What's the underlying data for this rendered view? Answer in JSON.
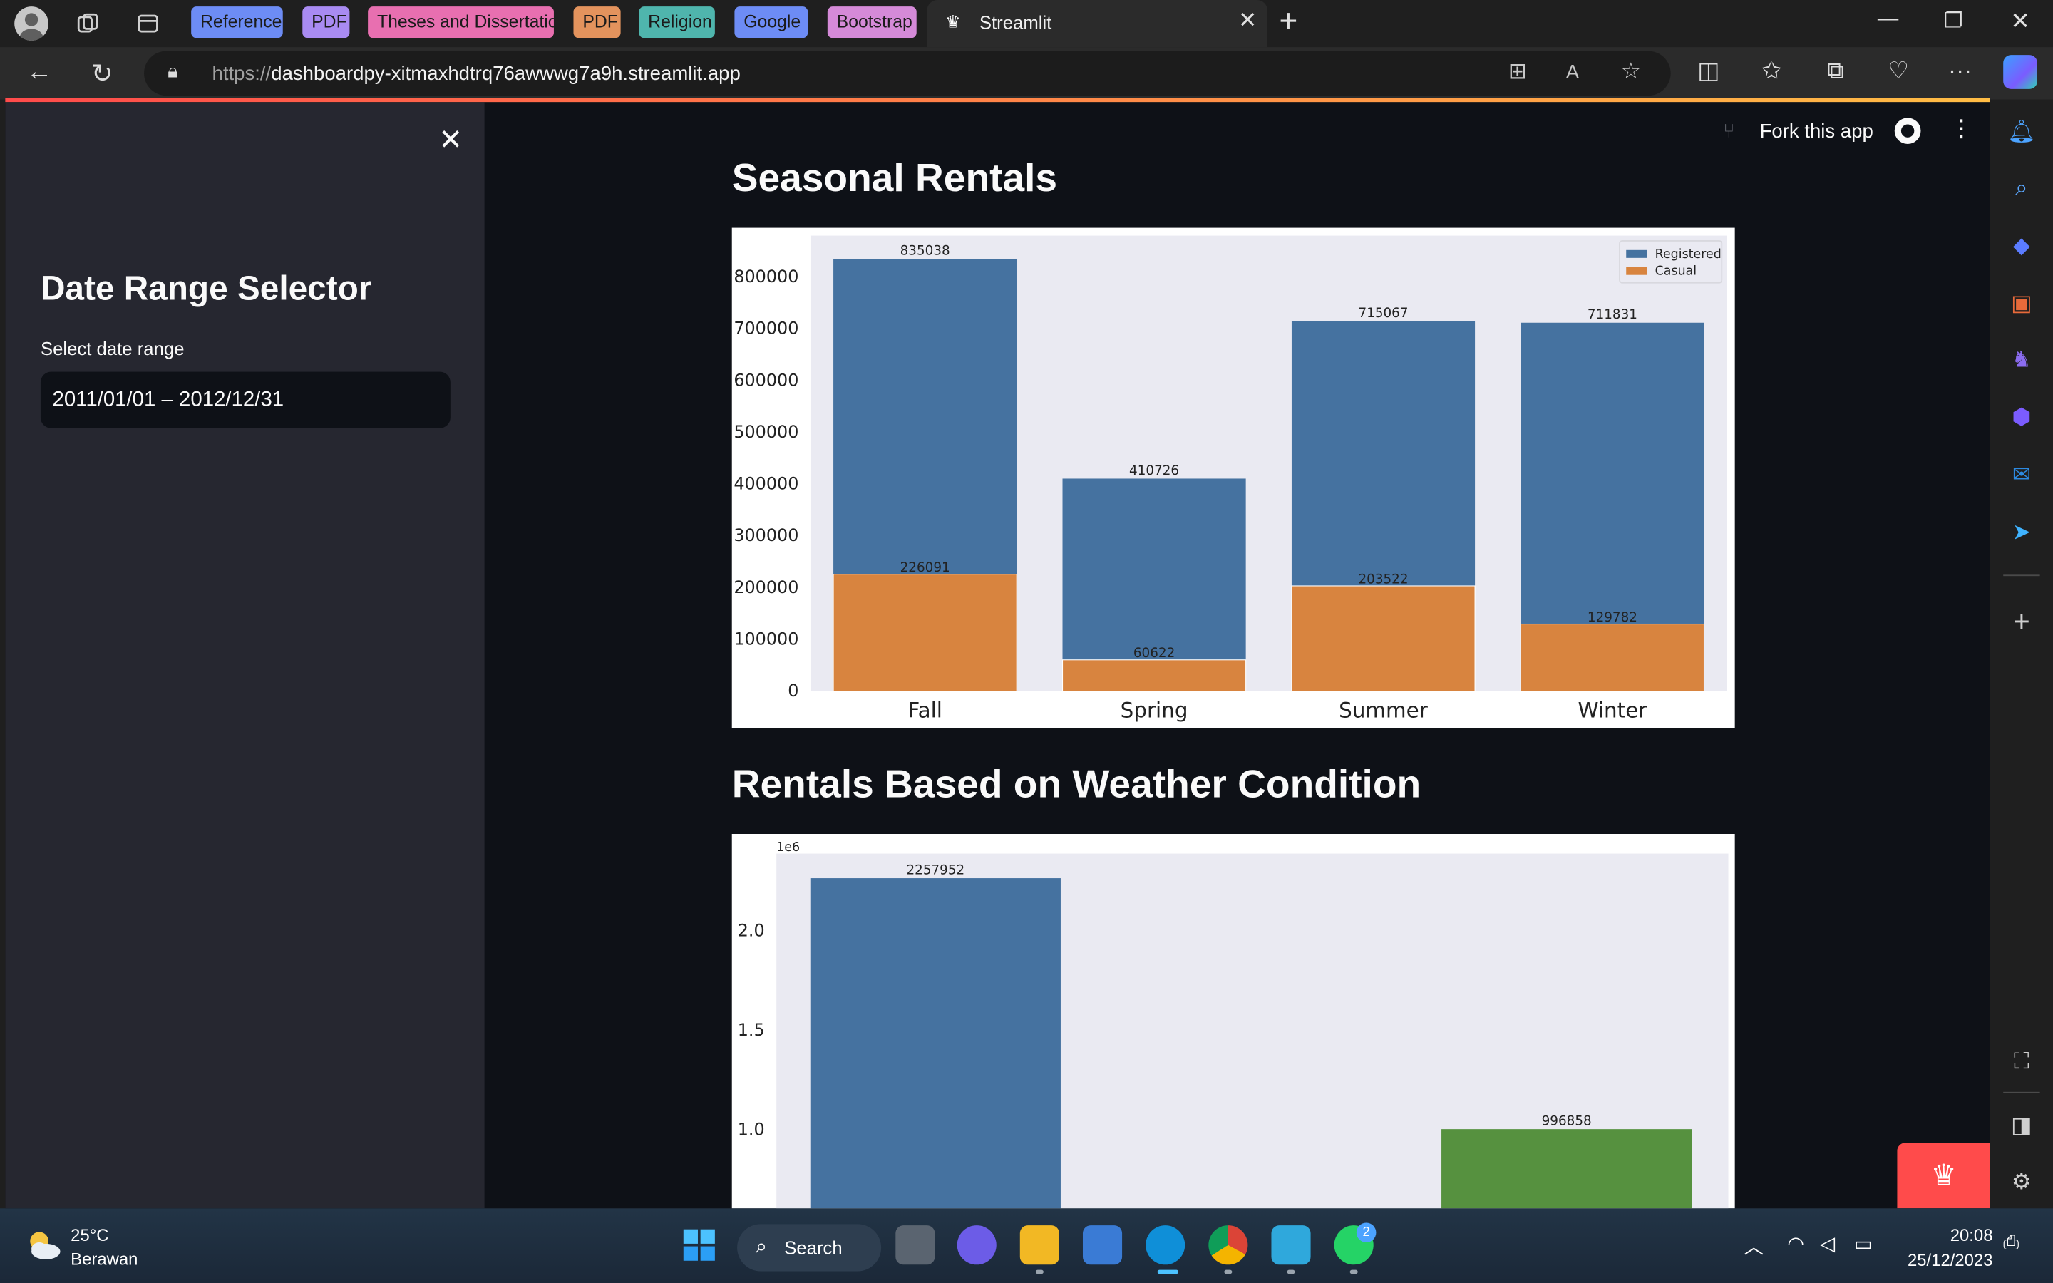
{
  "browser": {
    "tab_groups": [
      {
        "label": "Reference",
        "color": "#6d8cf5"
      },
      {
        "label": "PDF",
        "color": "#a98bf2"
      },
      {
        "label": "Theses and Dissertatio",
        "color": "#e86fb0"
      },
      {
        "label": "PDF",
        "color": "#e3935d"
      },
      {
        "label": "Religion",
        "color": "#4fb5ad"
      },
      {
        "label": "Google",
        "color": "#6d8cf5"
      },
      {
        "label": "Bootstrap",
        "color": "#d58ad8"
      }
    ],
    "active_tab_title": "Streamlit",
    "url_prefix": "https://",
    "url_host": "dashboardpy-xitmaxhdtrq76awwwg7a9h.streamlit.app"
  },
  "sidebar": {
    "title": "Date Range Selector",
    "date_label": "Select date range",
    "date_value": "2011/01/01 – 2012/12/31"
  },
  "header": {
    "fork_label": "Fork this app"
  },
  "sections": {
    "seasonal_title": "Seasonal Rentals",
    "weather_title": "Rentals Based on Weather Condition"
  },
  "chart_data": [
    {
      "type": "bar",
      "stacked": true,
      "categories": [
        "Fall",
        "Spring",
        "Summer",
        "Winter"
      ],
      "series": [
        {
          "name": "Registered",
          "values": [
            835038,
            410726,
            715067,
            711831
          ],
          "color": "#4572a0"
        },
        {
          "name": "Casual",
          "values": [
            226091,
            60622,
            203522,
            129782
          ],
          "color": "#d8843f"
        }
      ],
      "yticks": [
        "0",
        "100000",
        "200000",
        "300000",
        "400000",
        "500000",
        "600000",
        "700000",
        "800000"
      ],
      "ylim": [
        0,
        880000
      ],
      "legend": "top-right",
      "grid": false,
      "background": "#eaeaf2"
    },
    {
      "type": "bar",
      "offset_label": "1e6",
      "categories_visible": 3,
      "values": [
        2257952,
        null,
        996858
      ],
      "colors": [
        "#4572a0",
        null,
        "#56913f"
      ],
      "yticks": [
        "1.0",
        "1.5",
        "2.0"
      ],
      "y_visible_range": [
        0.6,
        2.3
      ],
      "background": "#eaeaf2"
    }
  ],
  "taskbar": {
    "weather_temp": "25°C",
    "weather_desc": "Berawan",
    "search_label": "Search",
    "whatsapp_badge": "2",
    "time": "20:08",
    "date": "25/12/2023"
  }
}
